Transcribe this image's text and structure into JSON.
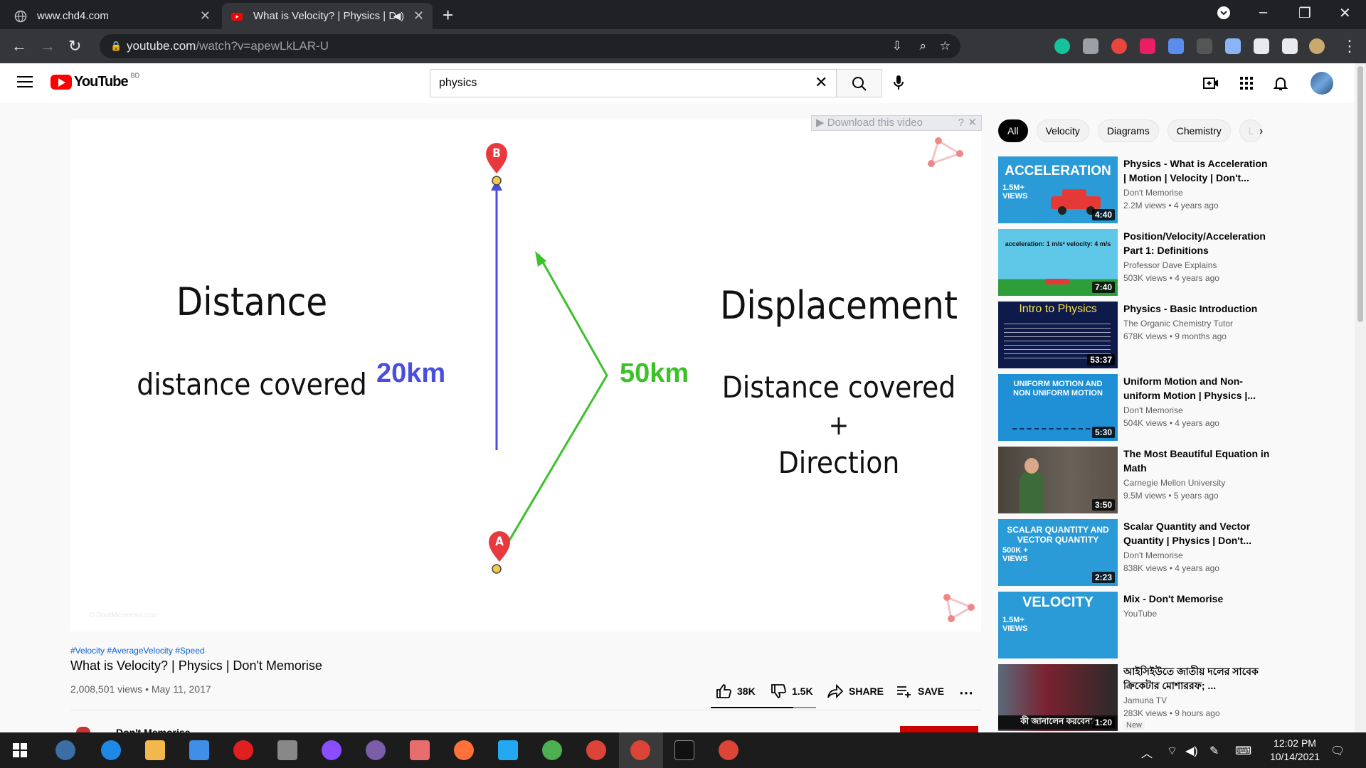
{
  "browser": {
    "tabs": [
      {
        "title": "www.chd4.com"
      },
      {
        "title": "What is Velocity? | Physics | D"
      }
    ],
    "url_host": "youtube.com",
    "url_path": "/watch?v=apewLkLAR-U"
  },
  "youtube": {
    "logo_text": "YouTube",
    "country_code": "BD",
    "search_query": "physics"
  },
  "player": {
    "download_bar": "Download this video",
    "left_heading": "Distance",
    "left_sub": "distance covered",
    "label_blue": "20km",
    "label_green": "50km",
    "right_heading": "Displacement",
    "right_line1": "Distance covered",
    "right_plus": "+",
    "right_line2": "Direction",
    "point_b": "B",
    "point_a": "A",
    "watermark": "© DontMemorise.com"
  },
  "video": {
    "hashtags": "#Velocity #AverageVelocity #Speed",
    "title": "What is Velocity? | Physics | Don't Memorise",
    "views_date": "2,008,501 views • May 11, 2017",
    "likes": "38K",
    "dislikes": "1.5K",
    "share": "SHARE",
    "save": "SAVE",
    "channel_partial": "Don't Memorise"
  },
  "chips": [
    "All",
    "Velocity",
    "Diagrams",
    "Chemistry",
    "L"
  ],
  "recommendations": [
    {
      "title": "Physics - What is Acceleration | Motion | Velocity | Don't...",
      "channel": "Don't Memorise",
      "meta": "2.2M views • 4 years ago",
      "duration": "4:40",
      "thumb_text": "ACCELERATION",
      "thumb_badge": "1.5M+ VIEWS",
      "thumb_color": "#2b9bd8"
    },
    {
      "title": "Position/Velocity/Acceleration Part 1: Definitions",
      "channel": "Professor Dave Explains",
      "meta": "503K views • 4 years ago",
      "duration": "7:40",
      "thumb_text": "acceleration: 1 m/s²   velocity: 4 m/s",
      "thumb_color": "#5fc8e8"
    },
    {
      "title": "Physics - Basic Introduction",
      "channel": "The Organic Chemistry Tutor",
      "meta": "678K views • 9 months ago",
      "duration": "53:37",
      "thumb_text": "Intro to Physics",
      "thumb_color": "#0d1a4a"
    },
    {
      "title": "Uniform Motion and Non-uniform Motion | Physics |...",
      "channel": "Don't Memorise",
      "meta": "504K views • 4 years ago",
      "duration": "5:30",
      "thumb_text": "UNIFORM MOTION AND NON UNIFORM MOTION",
      "thumb_color": "#1f8fd6"
    },
    {
      "title": "The Most Beautiful Equation in Math",
      "channel": "Carnegie Mellon University",
      "meta": "9.5M views • 5 years ago",
      "duration": "3:50",
      "thumb_color": "#5a5248"
    },
    {
      "title": "Scalar Quantity and Vector Quantity | Physics | Don't...",
      "channel": "Don't Memorise",
      "meta": "838K views • 4 years ago",
      "duration": "2:23",
      "thumb_text": "SCALAR QUANTITY AND VECTOR QUANTITY",
      "thumb_badge": "500K + VIEWS",
      "thumb_color": "#2b9bd8"
    },
    {
      "title": "Mix - Don't Memorise",
      "channel": "YouTube",
      "meta": "",
      "duration": "",
      "thumb_text": "VELOCITY",
      "thumb_badge": "1.5M+ VIEWS",
      "thumb_color": "#2b9bd8"
    },
    {
      "title": "আইসিইউতে জাতীয় দলের সাবেক ক্রিকেটার মোশাররফ; ...",
      "channel": "Jamuna TV",
      "meta": "283K views • 9 hours ago",
      "duration": "1:20",
      "badge": "New",
      "thumb_text": "কী জানালেন করবেন?",
      "thumb_color": "#7a2230"
    }
  ],
  "taskbar": {
    "time": "12:02 PM",
    "date": "10/14/2021"
  }
}
